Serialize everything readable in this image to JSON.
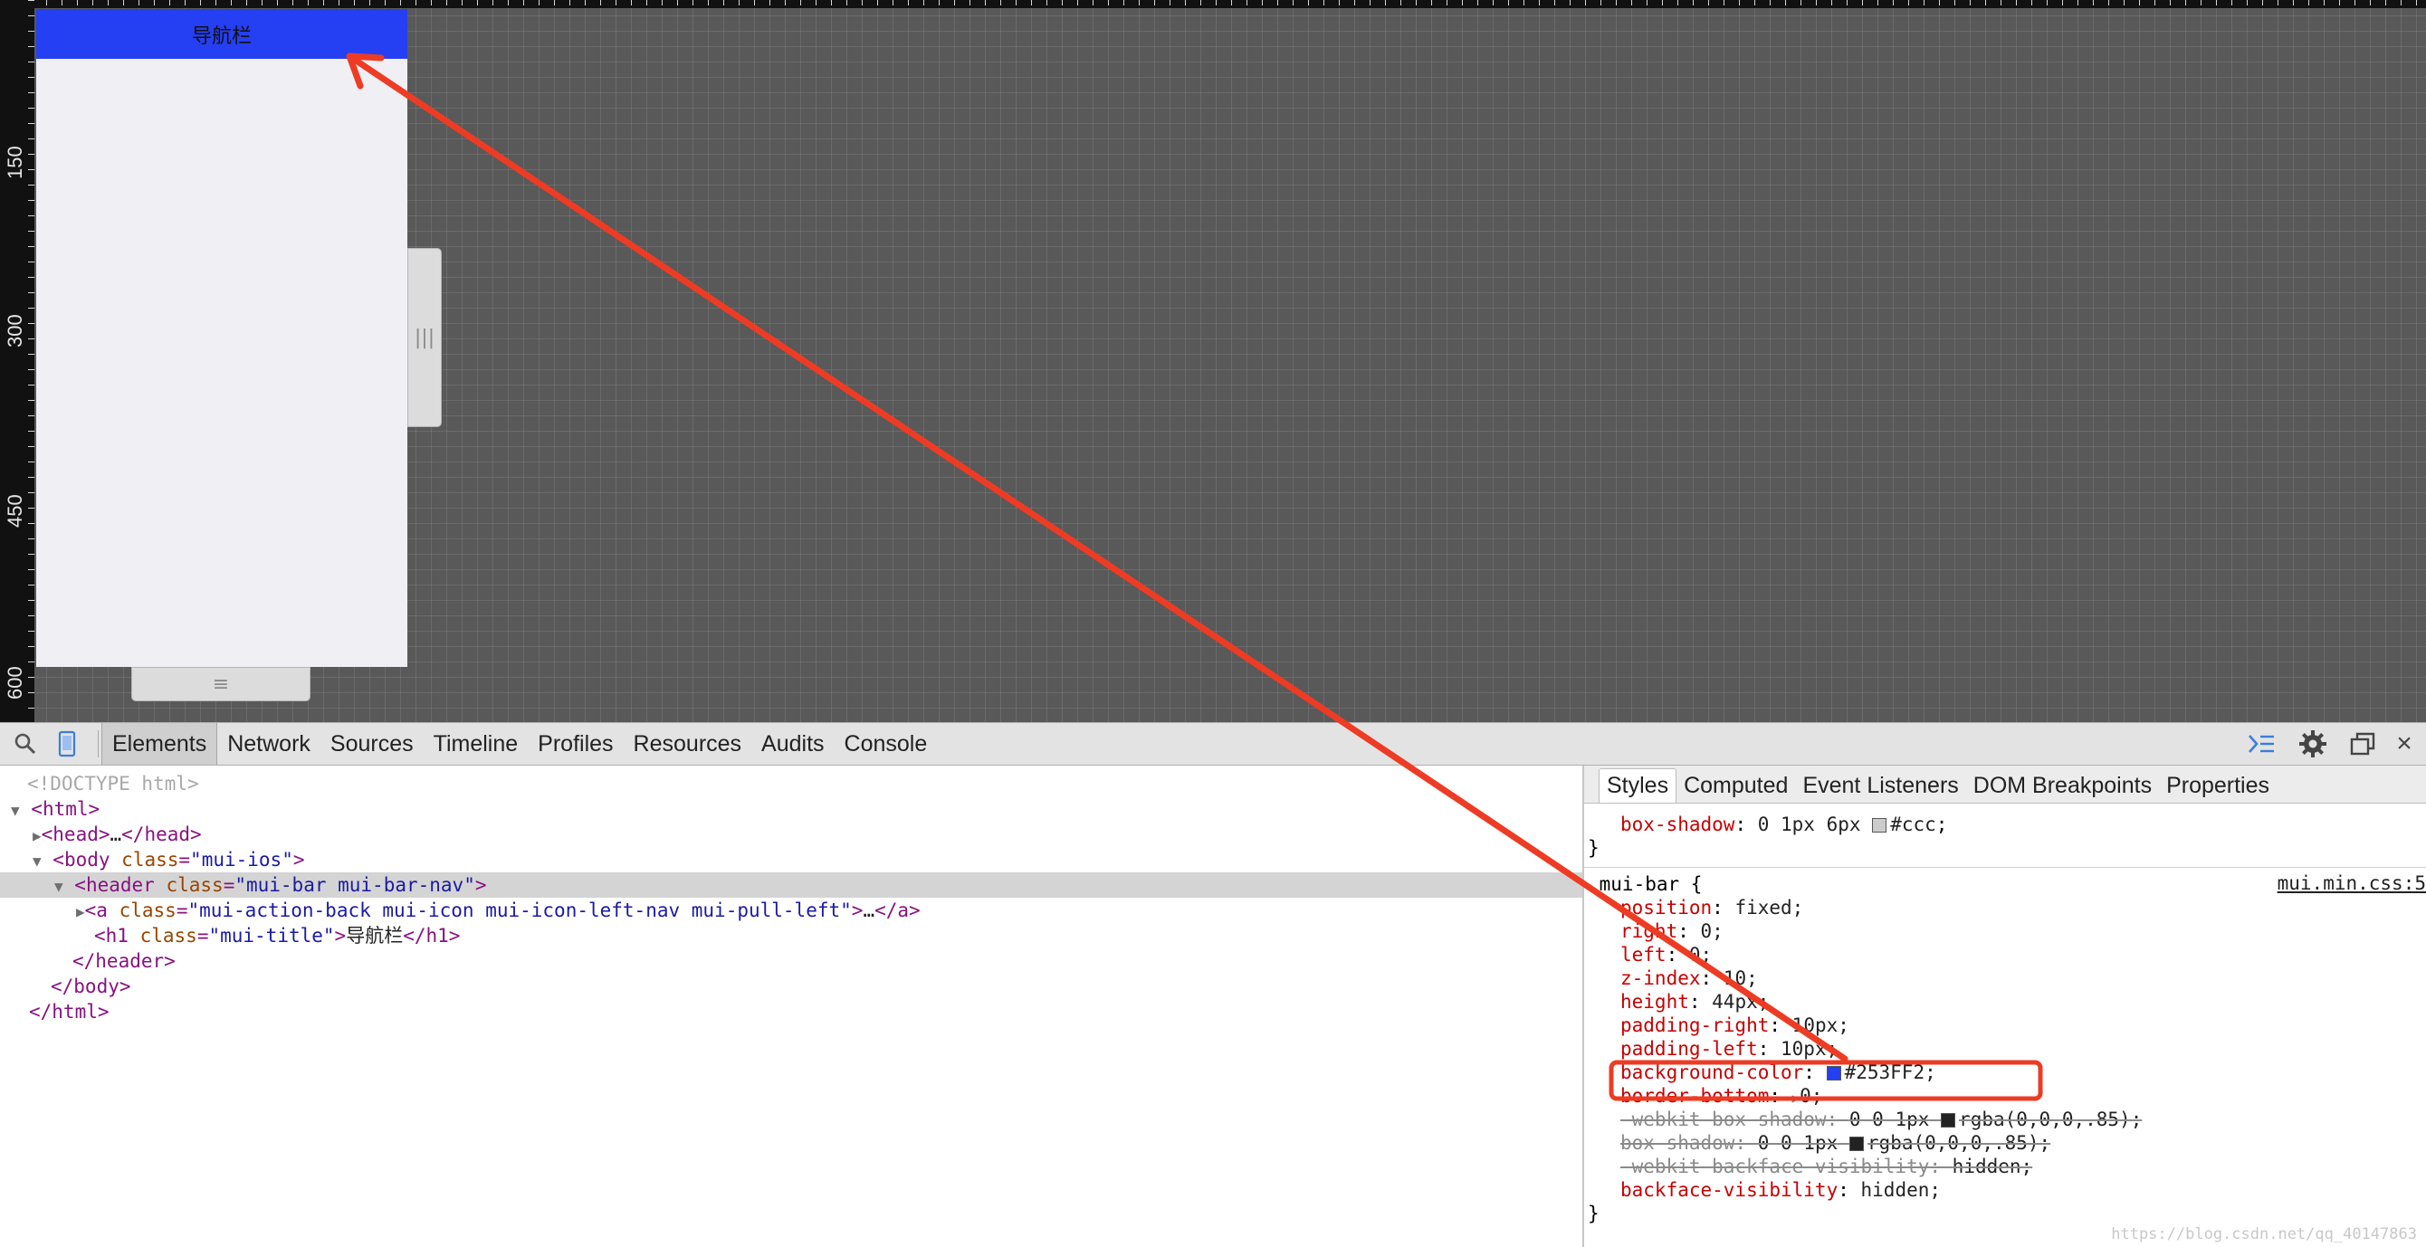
{
  "emulator": {
    "ruler_labels": [
      "150",
      "300",
      "450",
      "600"
    ],
    "nav_title": "导航栏",
    "resize_grip_vertical": "|||",
    "resize_grip_horizontal": "≡"
  },
  "toolbar": {
    "tabs": [
      "Elements",
      "Network",
      "Sources",
      "Timeline",
      "Profiles",
      "Resources",
      "Audits",
      "Console"
    ],
    "active_tab": "Elements",
    "icons": [
      "search-icon",
      "device-mode-icon",
      "drawer-toggle-icon",
      "settings-gear-icon",
      "dock-side-icon",
      "close-icon"
    ],
    "close_glyph": "×",
    "drawer_glyph": "≻≡"
  },
  "dom_tree": {
    "doctype": "<!DOCTYPE html>",
    "html_open": "<html>",
    "head": {
      "open": "<head>",
      "ellipsis": "…",
      "close": "</head>"
    },
    "body_open": {
      "tag": "<body",
      "attr": "class",
      "value": "\"mui-ios\"",
      "end": ">"
    },
    "header_open": {
      "tag": "<header",
      "attr": "class",
      "value": "\"mui-bar mui-bar-nav\"",
      "end": ">"
    },
    "anchor": {
      "tag": "<a",
      "attr": "class",
      "value": "\"mui-action-back mui-icon mui-icon-left-nav mui-pull-left\"",
      "end": ">",
      "ellipsis": "…",
      "close": "</a>"
    },
    "h1": {
      "tag": "<h1",
      "attr": "class",
      "value": "\"mui-title\"",
      "end": ">",
      "text": "导航栏",
      "close": "</h1>"
    },
    "header_close": "</header>",
    "body_close": "</body>",
    "html_close": "</html>"
  },
  "styles_pane": {
    "tabs": [
      "Styles",
      "Computed",
      "Event Listeners",
      "DOM Breakpoints",
      "Properties"
    ],
    "active_tab": "Styles",
    "prev_rule": {
      "prop": "box-shadow",
      "value": "0 1px 6px",
      "color": "#ccc",
      "close": "}"
    },
    "rule": {
      "selector": ".mui-bar {",
      "source": "mui.min.css:5",
      "close": "}",
      "declarations": [
        {
          "prop": "position",
          "value": "fixed;"
        },
        {
          "prop": "right",
          "value": "0;"
        },
        {
          "prop": "left",
          "value": "0;"
        },
        {
          "prop": "z-index",
          "value": "10;"
        },
        {
          "prop": "height",
          "value": "44px;"
        },
        {
          "prop": "padding-right",
          "value": "10px;"
        },
        {
          "prop": "padding-left",
          "value": "10px;"
        },
        {
          "prop": "background-color",
          "value": "#253FF2;",
          "swatch": "#253FF2"
        },
        {
          "prop": "border-bottom",
          "value": "0;",
          "triangle": true
        },
        {
          "prop": "-webkit-box-shadow",
          "value": "0 0 1px",
          "value2": "rgba(0,0,0,.85);",
          "swatch": "#222222",
          "struck": true
        },
        {
          "prop": "box-shadow",
          "value": "0 0 1px",
          "value2": "rgba(0,0,0,.85);",
          "swatch": "#222222",
          "struck": true
        },
        {
          "prop": "-webkit-backface-visibility",
          "value": "hidden;",
          "struck": true
        },
        {
          "prop": "backface-visibility",
          "value": "hidden;"
        }
      ]
    }
  },
  "watermark": "https://blog.csdn.net/qq_40147863",
  "colors": {
    "nav_bar": "#253FF2",
    "annotation": "#EE3B24",
    "grid_bg": "#595959",
    "selected_row": "#d4d4d4"
  }
}
